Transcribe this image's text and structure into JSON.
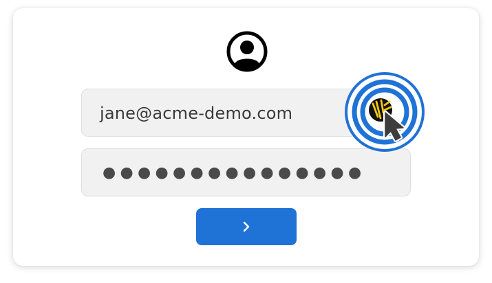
{
  "login_form": {
    "user_icon": "account-circle-icon",
    "email_value": "jane@acme-demo.com",
    "password_mask": "●●●●●●●●●●●●●●●",
    "submit_icon": "chevron-right-icon"
  },
  "autofill_target": {
    "icon": "keeper-logo-icon",
    "cursor_icon": "mouse-pointer-icon"
  },
  "colors": {
    "accent_blue": "#1f72d6",
    "field_bg": "#f1f1f1",
    "logo_gold": "#f5c518",
    "logo_black": "#111111"
  }
}
